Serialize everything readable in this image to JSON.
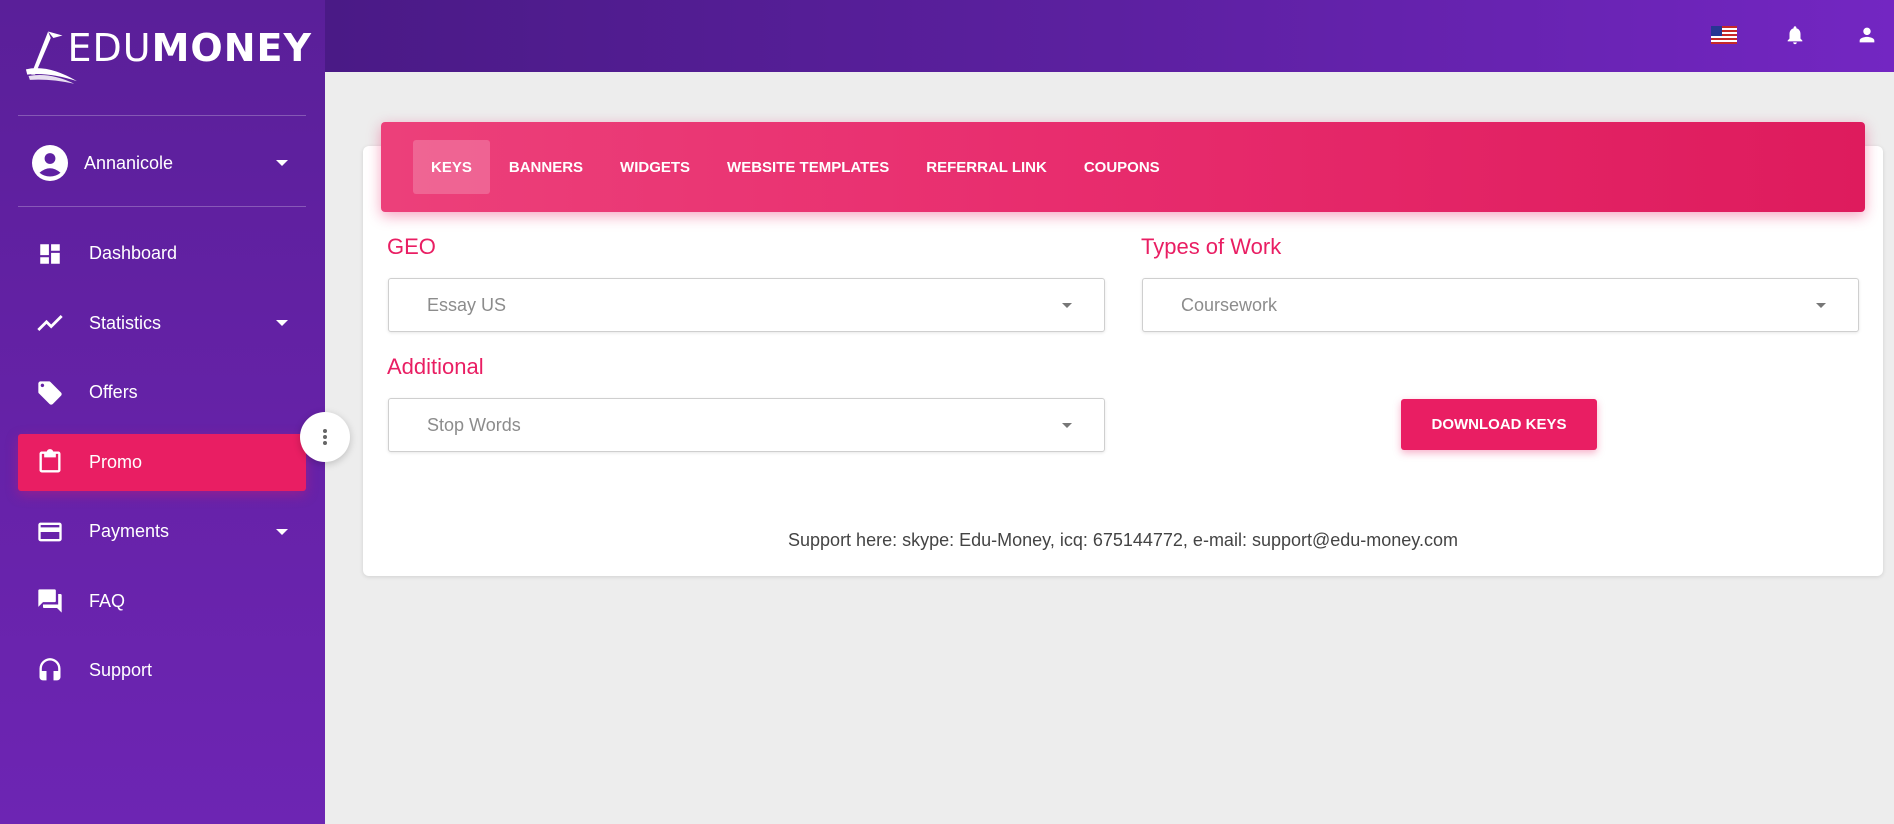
{
  "brand": {
    "logo_light": "EDU",
    "logo_bold": "MONEY"
  },
  "user": {
    "name": "Annanicole"
  },
  "sidebar": {
    "items": [
      {
        "label": "Dashboard",
        "icon": "dashboard-icon",
        "has_caret": false
      },
      {
        "label": "Statistics",
        "icon": "trending-up-icon",
        "has_caret": true
      },
      {
        "label": "Offers",
        "icon": "tag-icon",
        "has_caret": false
      },
      {
        "label": "Promo",
        "icon": "clipboard-icon",
        "has_caret": false,
        "active": true
      },
      {
        "label": "Payments",
        "icon": "credit-card-icon",
        "has_caret": true
      },
      {
        "label": "FAQ",
        "icon": "forum-icon",
        "has_caret": false
      },
      {
        "label": "Support",
        "icon": "headset-icon",
        "has_caret": false
      }
    ]
  },
  "topbar": {
    "icons": [
      "us-flag-icon",
      "bell-icon",
      "user-icon"
    ]
  },
  "tabs": [
    "KEYS",
    "BANNERS",
    "WIDGETS",
    "WEBSITE TEMPLATES",
    "REFERRAL LINK",
    "COUPONS"
  ],
  "active_tab": "KEYS",
  "form": {
    "geo": {
      "label": "GEO",
      "value": "Essay US"
    },
    "types_of_work": {
      "label": "Types of Work",
      "value": "Coursework"
    },
    "additional": {
      "label": "Additional",
      "value": "Stop Words"
    },
    "download_button": "DOWNLOAD KEYS"
  },
  "support_text": "Support here: skype: Edu-Money, icq: 675144772, e-mail: support@edu-money.com",
  "colors": {
    "accent": "#e91e63",
    "sidebar": "#6622a8",
    "topbar": "#5c20a0"
  }
}
